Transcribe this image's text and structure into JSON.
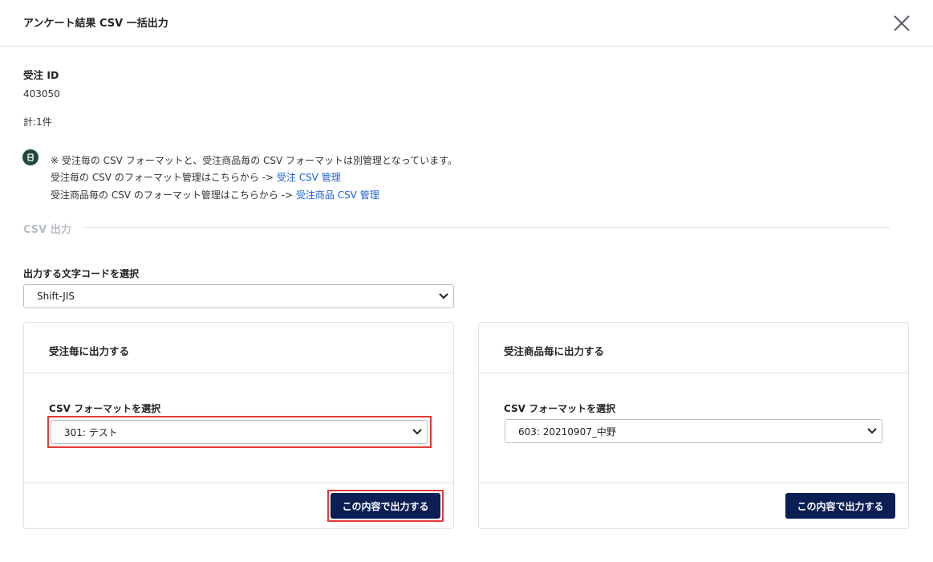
{
  "modal": {
    "title": "アンケート結果 CSV 一括出力",
    "close_icon": "close-icon"
  },
  "order": {
    "id_label": "受注 ID",
    "id_value": "403050",
    "count_text": "計:1件"
  },
  "notice": {
    "icon": "info-icon",
    "line1": "※ 受注毎の CSV フォーマットと、受注商品毎の CSV フォーマットは別管理となっています。",
    "line2_prefix": "受注毎の CSV のフォーマット管理はこちらから ->",
    "line2_link": "受注 CSV 管理",
    "line3_prefix": "受注商品毎の CSV のフォーマット管理はこちらから ->",
    "line3_link": "受注商品 CSV 管理"
  },
  "csv_section": {
    "title": "CSV 出力",
    "encoding_label": "出力する文字コードを選択",
    "encoding_value": "Shift-JIS"
  },
  "panels": [
    {
      "title": "受注毎に出力する",
      "format_label": "CSV フォーマットを選択",
      "format_value": "301: テスト",
      "button_label": "この内容で出力する",
      "highlighted": true
    },
    {
      "title": "受注商品毎に出力する",
      "format_label": "CSV フォーマットを選択",
      "format_value": "603: 20210907_中野",
      "button_label": "この内容で出力する",
      "highlighted": false
    }
  ],
  "colors": {
    "primary_button": "#0b1f55",
    "link": "#1e5fd4",
    "highlight": "#e53935",
    "info_icon_bg": "#1f4a3a"
  }
}
